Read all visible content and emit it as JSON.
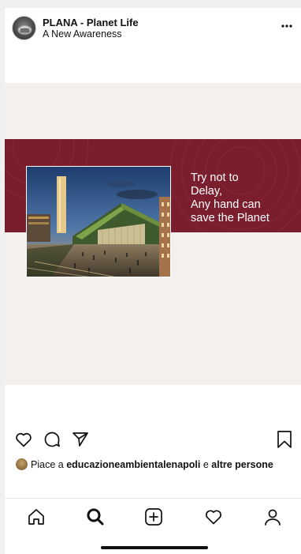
{
  "header": {
    "account_name": "PLANA - Planet Life",
    "account_subtitle": "A New Awareness",
    "avatar_icon": "avatar-image",
    "more_icon": "more-dots-icon"
  },
  "post": {
    "slogan_lines": [
      "Try not to",
      "Delay,",
      "Any hand can",
      "save the Planet"
    ],
    "band_color": "#7a1e2e",
    "background_color": "#f4f0ed"
  },
  "actions": {
    "like_icon": "heart-icon",
    "comment_icon": "comment-icon",
    "share_icon": "send-icon",
    "save_icon": "bookmark-icon"
  },
  "likes": {
    "prefix": "Piace a",
    "user": "educazioneambientalenapoli",
    "joiner": "e",
    "others": "altre persone"
  },
  "tabbar": {
    "items": [
      "home-icon",
      "search-icon",
      "add-post-icon",
      "activity-heart-icon",
      "profile-icon"
    ],
    "active": "search-icon"
  }
}
